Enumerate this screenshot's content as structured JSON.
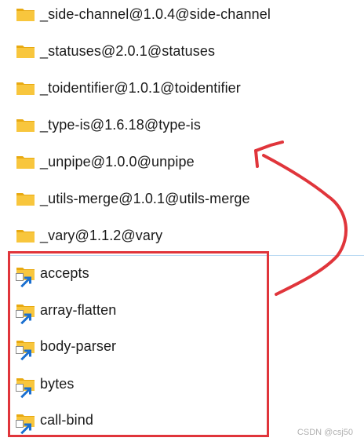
{
  "folders_top": [
    {
      "name": "_side-channel@1.0.4@side-channel"
    },
    {
      "name": "_statuses@2.0.1@statuses"
    },
    {
      "name": "_toidentifier@1.0.1@toidentifier"
    },
    {
      "name": "_type-is@1.6.18@type-is"
    },
    {
      "name": "_unpipe@1.0.0@unpipe"
    },
    {
      "name": "_utils-merge@1.0.1@utils-merge"
    },
    {
      "name": "_vary@1.1.2@vary"
    }
  ],
  "folders_shortcuts": [
    {
      "name": "accepts"
    },
    {
      "name": "array-flatten"
    },
    {
      "name": "body-parser"
    },
    {
      "name": "bytes"
    },
    {
      "name": "call-bind"
    }
  ],
  "watermark": "CSDN @csj50",
  "colors": {
    "folder_fill": "#f8c63d",
    "folder_tab": "#e8a911",
    "highlight_box": "#e0353b",
    "arrow": "#e0353b"
  },
  "icons": {
    "folder": "folder-icon",
    "shortcut": "shortcut-arrow-icon"
  }
}
